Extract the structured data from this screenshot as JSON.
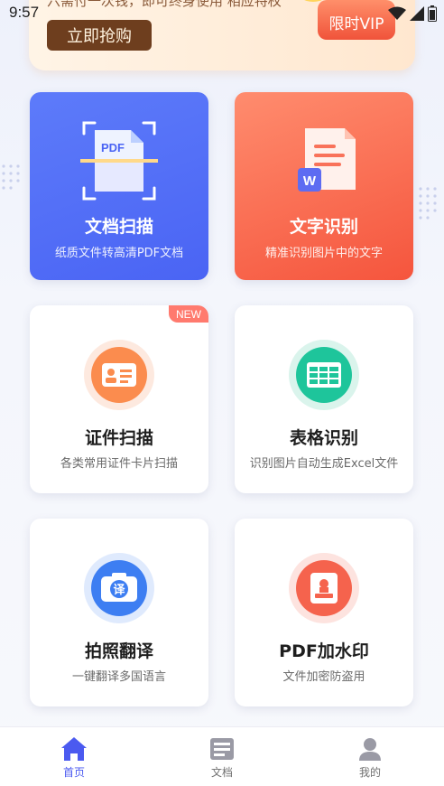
{
  "status_bar": {
    "time": "9:57"
  },
  "banner": {
    "text": "六需付一次钱，即可终身使用 相应特权",
    "button_label": "立即抢购",
    "vip_label": "限时VIP"
  },
  "cards": [
    {
      "title": "文档扫描",
      "subtitle": "纸质文件转高清PDF文档",
      "icon_text": "PDF"
    },
    {
      "title": "文字识别",
      "subtitle": "精准识别图片中的文字",
      "icon_text": "W"
    },
    {
      "title": "证件扫描",
      "subtitle": "各类常用证件卡片扫描",
      "badge": "NEW"
    },
    {
      "title": "表格识别",
      "subtitle": "识别图片自动生成Excel文件"
    },
    {
      "title": "拍照翻译",
      "subtitle": "一键翻译多国语言",
      "icon_text": "译"
    },
    {
      "title": "PDF加水印",
      "subtitle": "文件加密防盗用"
    }
  ],
  "nav": {
    "items": [
      {
        "label": "首页",
        "icon": "home-icon",
        "active": true
      },
      {
        "label": "文档",
        "icon": "document-icon",
        "active": false
      },
      {
        "label": "我的",
        "icon": "profile-icon",
        "active": false
      }
    ]
  },
  "colors": {
    "accent": "#4b5af0",
    "scan_card": "#4f6af6",
    "ocr_card": "#f6593f",
    "banner_button": "#6e3e1e"
  }
}
